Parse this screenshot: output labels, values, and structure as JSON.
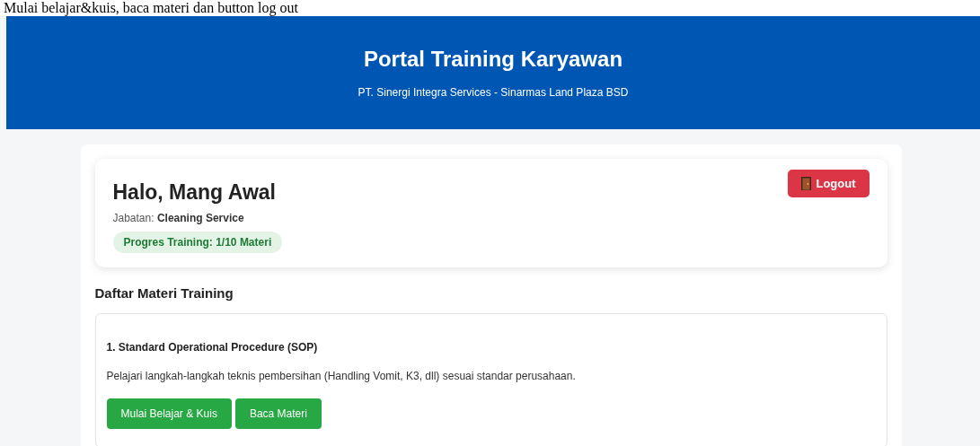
{
  "caption": "Mulai belajar&kuis, baca materi dan button log out",
  "header": {
    "title": "Portal Training Karyawan",
    "subtitle": "PT. Sinergi Integra Services - Sinarmas Land Plaza BSD"
  },
  "profile": {
    "greeting": "Halo, Mang Awal",
    "position_label": "Jabatan:",
    "position": "Cleaning Service",
    "progress": "Progres Training: 1/10 Materi",
    "logout": "Logout"
  },
  "section_title": "Daftar Materi Training",
  "materials": [
    {
      "title": "1. Standard Operational Procedure (SOP)",
      "description": "Pelajari langkah-langkah teknis pembersihan (Handling Vomit, K3, dll) sesuai standar perusahaan.",
      "buttons": [
        "Mulai Belajar & Kuis",
        "Baca Materi"
      ]
    }
  ]
}
